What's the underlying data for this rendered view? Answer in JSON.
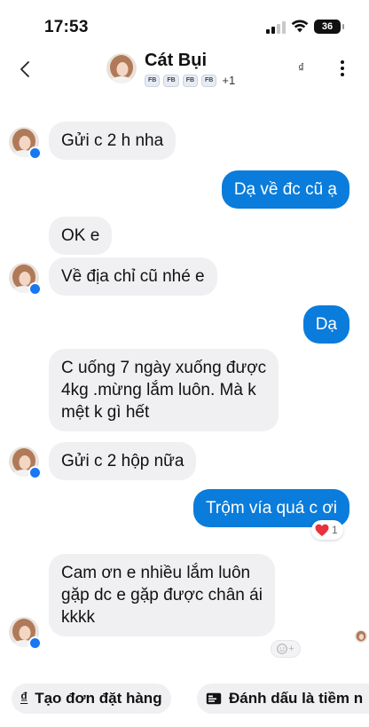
{
  "status_bar": {
    "time": "17:53",
    "battery": "36"
  },
  "header": {
    "contact_name": "Cát Bụi",
    "badges": [
      "FB",
      "FB",
      "FB",
      "FB"
    ],
    "badges_more": "+1",
    "currency_symbol": "₫"
  },
  "messages": [
    {
      "from": "contact",
      "text": "Gửi c 2 h nha"
    },
    {
      "from": "me",
      "text": "Dạ về đc cũ ạ"
    },
    {
      "from": "contact",
      "text": "OK e"
    },
    {
      "from": "contact",
      "text": "Về địa chỉ cũ nhé e"
    },
    {
      "from": "me",
      "text": "Dạ"
    },
    {
      "from": "contact",
      "lines": [
        "C uống 7 ngày xuống được",
        "4kg .mừng lắm luôn. Mà k",
        "mệt k gì hết"
      ]
    },
    {
      "from": "contact",
      "text": "Gửi c 2 hộp nữa"
    },
    {
      "from": "me",
      "text": "Trộm vía quá c ơi",
      "reaction": {
        "icon": "heart-icon",
        "count": "1"
      }
    },
    {
      "from": "contact",
      "lines": [
        "Cam ơn e nhiều lắm luôn",
        "gặp dc e gặp được chân ái",
        "kkkk"
      ]
    }
  ],
  "actions": {
    "create_order": {
      "label": "Tạo đơn đặt hàng",
      "icon": "₫"
    },
    "mark_lead": {
      "label": "Đánh dấu là tiềm n",
      "icon": "tag-card-icon"
    }
  },
  "colors": {
    "outgoing_bubble": "#0a7cdb",
    "incoming_bubble": "#f0f0f2",
    "messenger_badge": "#1877f2",
    "reaction_heart": "#e8323c"
  }
}
